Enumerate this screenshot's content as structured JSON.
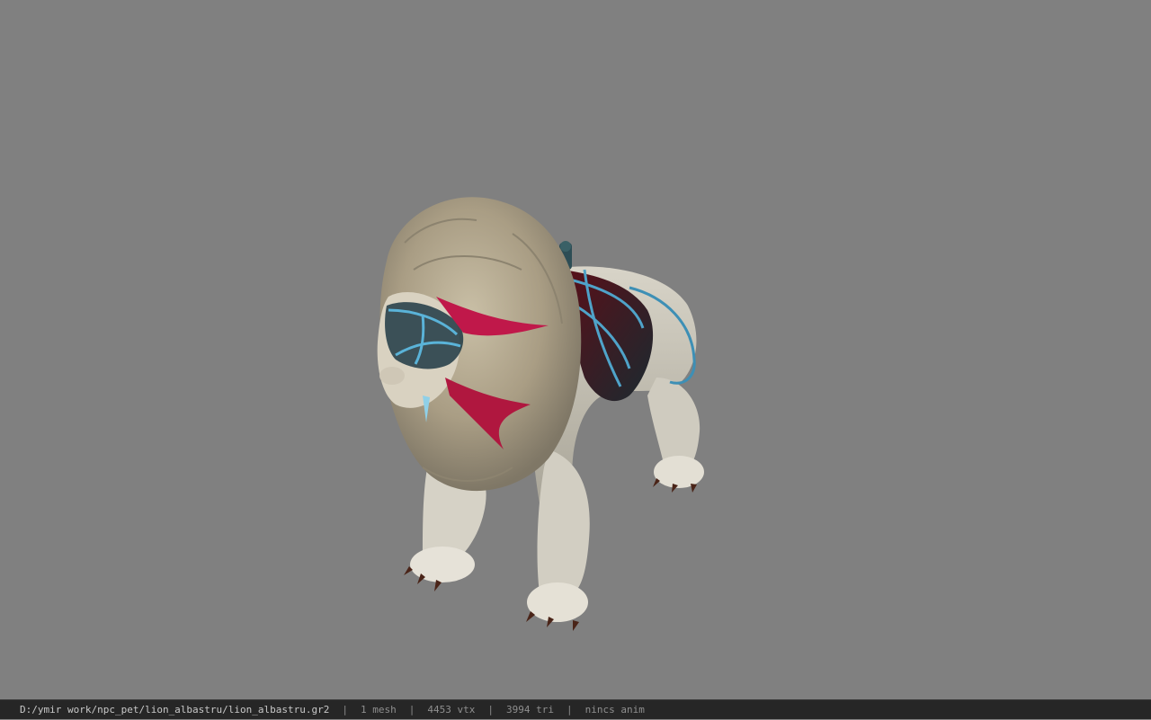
{
  "viewer": {
    "background_color": "#808080",
    "model_name": "lion_albastru"
  },
  "statusbar": {
    "file_path": "D:/ymir work/npc_pet/lion_albastru/lion_albastru.gr2",
    "separator": "|",
    "mesh_count": "1 mesh",
    "vertex_count": "4453 vtx",
    "triangle_count": "3994 tri",
    "animation": "nincs anim"
  }
}
